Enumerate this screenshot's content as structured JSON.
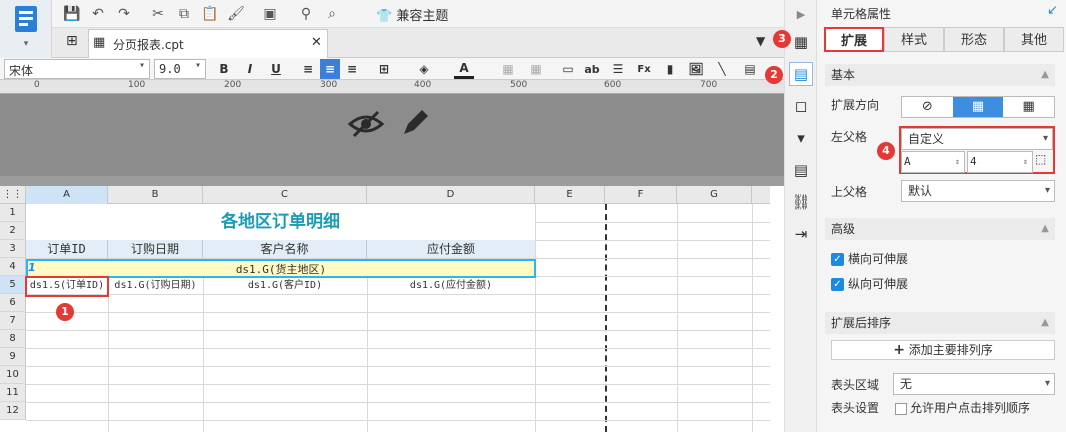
{
  "topbar": {
    "compat_theme_label": "兼容主题"
  },
  "tab": {
    "filename": "分页报表.cpt"
  },
  "format": {
    "font_name": "宋体",
    "font_size": "9.0"
  },
  "ruler": {
    "ticks": [
      "0",
      "100",
      "200",
      "300",
      "400",
      "500",
      "600",
      "700"
    ]
  },
  "grid": {
    "columns": [
      "A",
      "B",
      "C",
      "D",
      "E",
      "F",
      "G"
    ],
    "rows": [
      "1",
      "2",
      "3",
      "4",
      "5",
      "6",
      "7",
      "8",
      "9",
      "10",
      "11",
      "12"
    ],
    "title": "各地区订单明细",
    "headers": [
      "订单ID",
      "订购日期",
      "客户名称",
      "应付金额"
    ],
    "row4": "ds1.G(货主地区)",
    "row4_marker": "1",
    "row5": [
      "ds1.S(订单ID)",
      "ds1.G(订购日期)",
      "ds1.G(客户ID)",
      "ds1.G(应付金额)"
    ]
  },
  "panel": {
    "title": "单元格属性",
    "tabs": [
      "扩展",
      "样式",
      "形态",
      "其他"
    ],
    "basic_section": "基本",
    "expand_direction_label": "扩展方向",
    "left_parent_label": "左父格",
    "left_parent_value": "自定义",
    "left_col_value": "A",
    "left_row_value": "4",
    "up_parent_label": "上父格",
    "up_parent_value": "默认",
    "advanced_section": "高级",
    "horizontal_expand": "横向可伸展",
    "vertical_expand": "纵向可伸展",
    "sort_section": "扩展后排序",
    "add_sort_label": "添加主要排列序",
    "header_area_label": "表头区域",
    "header_area_value": "无",
    "header_setting_label": "表头设置",
    "allow_click_sort": "允许用户点击排列顺序"
  },
  "badges": [
    "1",
    "2",
    "3",
    "4"
  ],
  "colors": {
    "accent": "#1e88e5",
    "title": "#1a9bb6",
    "highlight": "#fff9c4",
    "marker": "#e53935"
  }
}
